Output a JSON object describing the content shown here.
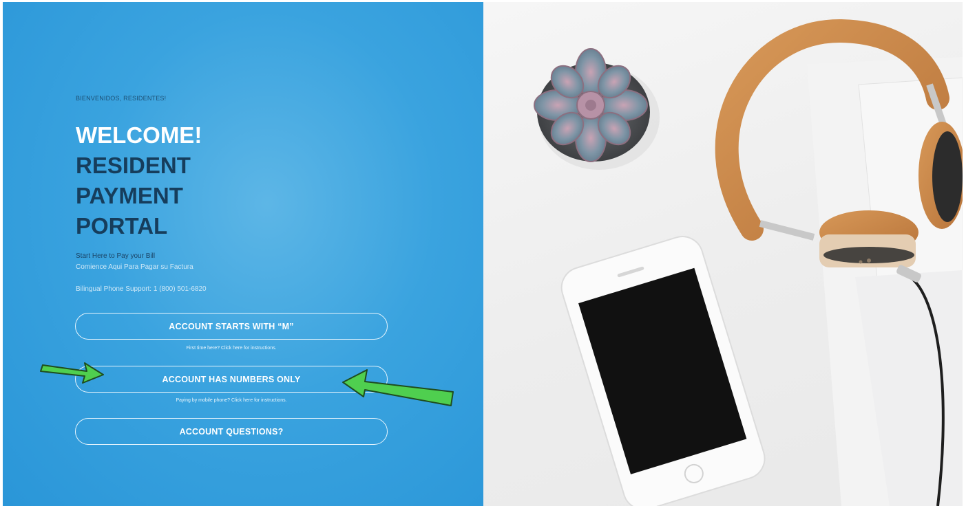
{
  "hero": {
    "kicker": "BIENVENIDOS, RESIDENTES!",
    "title_welcome": "WELCOME!",
    "title_line1": "RESIDENT",
    "title_line2": "PAYMENT",
    "title_line3": "PORTAL",
    "start_en": "Start Here to Pay your Bill",
    "start_es": "Comience Aqui Para Pagar su Factura",
    "phone_support": "Bilingual Phone Support: 1 (800) 501-6820"
  },
  "buttons": {
    "account_m": "ACCOUNT STARTS WITH “M”",
    "account_m_hint": "First time here? Click here for instructions.",
    "account_numbers": "ACCOUNT HAS NUMBERS ONLY",
    "account_numbers_hint": "Paying by mobile phone? Click here for instructions.",
    "account_questions": "ACCOUNT QUESTIONS?"
  },
  "colors": {
    "panel_blue": "#3aa3df",
    "heading_navy": "#163d5c",
    "annotation_green": "#4fcf4f"
  },
  "icons": {
    "annotation_arrows": "green-arrow-icon"
  }
}
